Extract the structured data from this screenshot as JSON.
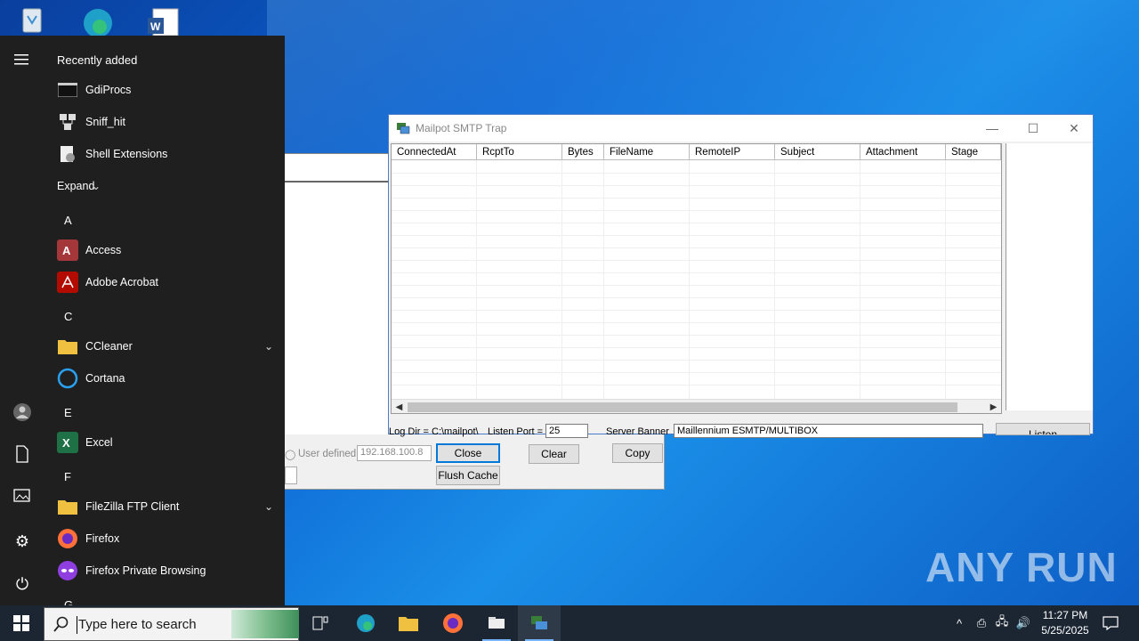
{
  "desktop": {
    "icons": [
      "recycle-bin-icon",
      "edge-icon",
      "word-icon"
    ]
  },
  "start_menu": {
    "recent_header": "Recently added",
    "recent_items": [
      {
        "label": "GdiProcs",
        "icon": "console-icon"
      },
      {
        "label": "Sniff_hit",
        "icon": "network-icon"
      },
      {
        "label": "Shell Extensions",
        "icon": "shell-ext-icon"
      }
    ],
    "expand_label": "Expand",
    "letter_a": "A",
    "letter_c": "C",
    "letter_e": "E",
    "letter_f": "F",
    "letter_g": "G",
    "apps": {
      "access": "Access",
      "acrobat": "Adobe Acrobat",
      "ccleaner": "CCleaner",
      "cortana": "Cortana",
      "excel": "Excel",
      "filezilla": "FileZilla FTP Client",
      "firefox": "Firefox",
      "firefox_private": "Firefox Private Browsing"
    }
  },
  "dialog_fragment": {
    "radio_label": "User defined",
    "ip_value": "192.168.100.8",
    "close_label": "Close",
    "clear_label": "Clear",
    "copy_label": "Copy",
    "flush_label": "Flush Cache"
  },
  "mailpot": {
    "title": "Mailpot SMTP Trap",
    "columns": [
      "ConnectedAt",
      "RcptTo",
      "Bytes",
      "FileName",
      "RemoteIP",
      "Subject",
      "Attachment",
      "Stage"
    ],
    "log_dir_label": "Log Dir = C:\\mailpot\\",
    "listen_port_label": "Listen Port =",
    "listen_port_value": "25",
    "server_banner_label": "Server Banner",
    "server_banner_value": "Maillennium ESMTP/MULTIBOX",
    "listen_button": "Listen"
  },
  "taskbar": {
    "search_placeholder": "Type here to search",
    "time": "11:27 PM",
    "date": "5/25/2025"
  },
  "watermark": "ANY RUN"
}
